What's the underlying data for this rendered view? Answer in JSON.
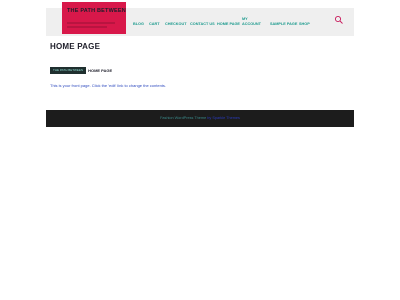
{
  "site": {
    "logo_text": "THE PATH BETWEEN"
  },
  "nav": {
    "items": [
      {
        "label": "BLOG"
      },
      {
        "label": "CART"
      },
      {
        "label": "CHECKOUT"
      },
      {
        "label": "CONTACT US"
      },
      {
        "label": "HOME PAGE"
      },
      {
        "label": "MY ACCOUNT"
      },
      {
        "label": "SAMPLE PAGE"
      },
      {
        "label": "SHOP"
      }
    ],
    "search_icon": "search-icon"
  },
  "main": {
    "title": "HOME PAGE",
    "breadcrumb": {
      "home": "THE PATH BETWEEN",
      "current": "HOME PAGE"
    },
    "content": "This is your front page. Click the 'edit' link to change the contents."
  },
  "footer": {
    "text": "Fashion WordPress Theme",
    "link": "by Sparkle Themes"
  },
  "colors": {
    "accent": "#d8184a",
    "nav": "#1b9a8d",
    "footer_bg": "#1c1c1c"
  }
}
